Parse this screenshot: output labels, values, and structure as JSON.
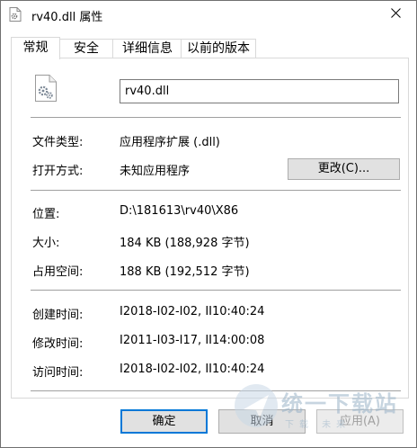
{
  "window": {
    "title": "rv40.dll 属性",
    "close_glyph": "✕"
  },
  "tabs": [
    {
      "label": "常规",
      "active": true
    },
    {
      "label": "安全",
      "active": false
    },
    {
      "label": "详细信息",
      "active": false
    },
    {
      "label": "以前的版本",
      "active": false
    }
  ],
  "file": {
    "name": "rv40.dll",
    "icon": "dll-gear-file-icon"
  },
  "properties": {
    "type_label": "文件类型:",
    "type_value": "应用程序扩展 (.dll)",
    "opens_with_label": "打开方式:",
    "opens_with_value": "未知应用程序",
    "change_button": "更改(C)...",
    "location_label": "位置:",
    "location_value": "D:\\181613\\rv40\\X86",
    "size_label": "大小:",
    "size_value": "184 KB (188,928 字节)",
    "size_on_disk_label": "占用空间:",
    "size_on_disk_value": "188 KB (192,512 字节)",
    "created_label": "创建时间:",
    "created_value": "I2018-I02-I02, II10:40:24",
    "modified_label": "修改时间:",
    "modified_value": "I2011-I03-I17, II14:00:08",
    "accessed_label": "访问时间:",
    "accessed_value": "I2018-I02-I02, II10:40:24"
  },
  "buttons": {
    "ok": "确定",
    "cancel": "取消",
    "apply": "应用(A)"
  },
  "watermark": {
    "text": "统一下载站",
    "sub": "下载 未来"
  },
  "colors": {
    "accent": "#0078d7",
    "button_face": "#e1e1e1",
    "disabled_text": "#a0a0a0"
  }
}
